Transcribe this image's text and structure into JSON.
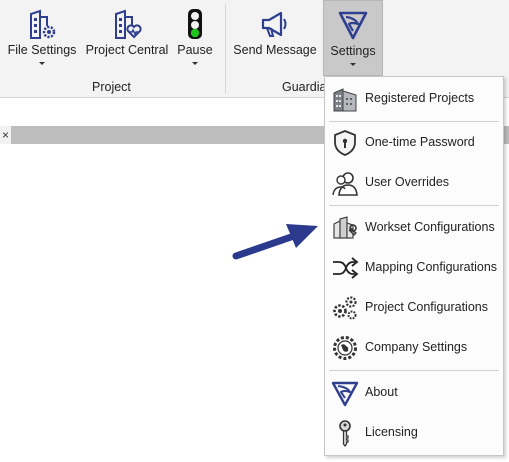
{
  "ribbon": {
    "buttons": [
      {
        "label": "File Settings",
        "icon": "file-settings-icon"
      },
      {
        "label": "Project Central",
        "icon": "project-central-icon"
      },
      {
        "label": "Pause",
        "icon": "traffic-light-icon"
      },
      {
        "label": "Send Message",
        "icon": "megaphone-icon"
      },
      {
        "label": "Settings",
        "icon": "guardian-logo-icon"
      }
    ],
    "groups": {
      "project": "Project",
      "guardian": "Guardian"
    }
  },
  "tab_close": "×",
  "menu": {
    "items": [
      {
        "label": "Registered Projects",
        "icon": "building-icon"
      },
      {
        "label": "One-time Password",
        "icon": "shield-lock-icon"
      },
      {
        "label": "User Overrides",
        "icon": "users-icon"
      },
      {
        "label": "Workset Configurations",
        "icon": "workset-icon"
      },
      {
        "label": "Mapping Configurations",
        "icon": "mapping-arrows-icon"
      },
      {
        "label": "Project Configurations",
        "icon": "gears-icon"
      },
      {
        "label": "Company Settings",
        "icon": "globe-gear-icon"
      },
      {
        "label": "About",
        "icon": "guardian-logo-icon"
      },
      {
        "label": "Licensing",
        "icon": "key-icon"
      }
    ]
  },
  "colors": {
    "brand_blue": "#2e3f8f",
    "arrow_blue": "#2b3a8c",
    "ribbon_bg": "#f3f3f3",
    "active_bg": "#c9c9c9"
  }
}
